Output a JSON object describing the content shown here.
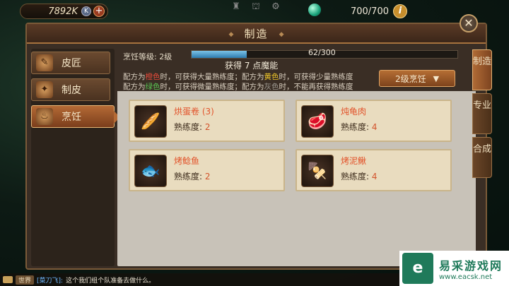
{
  "hud": {
    "gold": "7892K",
    "currency_badge": "K",
    "add_symbol": "+",
    "energy": "700/700",
    "info_symbol": "i"
  },
  "panel": {
    "title": "制造",
    "close_symbol": "✕"
  },
  "sidebar": {
    "items": [
      {
        "label": "皮匠",
        "icon": "leather-scroll-icon"
      },
      {
        "label": "制皮",
        "icon": "tanning-icon"
      },
      {
        "label": "烹饪",
        "icon": "cooking-pot-icon"
      }
    ],
    "active_index": 2
  },
  "skill": {
    "level_label": "烹饪等级: 2级",
    "progress_text": "62/300",
    "progress_value": 62,
    "progress_max": 300,
    "gain_text": "获得 7 点魔能"
  },
  "rules": {
    "line1": {
      "a": "配方为",
      "c1": "橙色",
      "b": "时，可获得大量熟练度；配方为",
      "c2": "黄色",
      "c": "时，可获得少量熟练度"
    },
    "line2": {
      "a": "配方为",
      "c1": "绿色",
      "b": "时，可获得微量熟练度；配方为",
      "c2": "灰色",
      "c": "时，不能再获得熟练度"
    }
  },
  "tier_select": {
    "value": "2级烹饪"
  },
  "recipes": [
    {
      "name": "烘蛋卷",
      "count": "(3)",
      "prof_label": "熟练度:",
      "prof": "2",
      "icon": "egg-roll-icon"
    },
    {
      "name": "炖龟肉",
      "count": "",
      "prof_label": "熟练度:",
      "prof": "4",
      "icon": "turtle-meat-icon"
    },
    {
      "name": "烤鲶鱼",
      "count": "",
      "prof_label": "熟练度:",
      "prof": "2",
      "icon": "grilled-catfish-icon"
    },
    {
      "name": "烤泥鳅",
      "count": "",
      "prof_label": "熟练度:",
      "prof": "4",
      "icon": "grilled-loach-icon"
    }
  ],
  "right_tabs": [
    {
      "label": "制造"
    },
    {
      "label": "专业"
    },
    {
      "label": "合成"
    }
  ],
  "chat": {
    "channel": "世界",
    "user": "[菜刀飞]:",
    "message": "这个我们组个队准备去做什么。"
  },
  "watermark": {
    "name": "易采游戏网",
    "url": "www.eacsk.net"
  },
  "colors": {
    "orange": "#e24a3a",
    "yellow": "#e8c12a",
    "green": "#58c052",
    "gray": "#9a968e",
    "progress": "#2d7cb0"
  }
}
